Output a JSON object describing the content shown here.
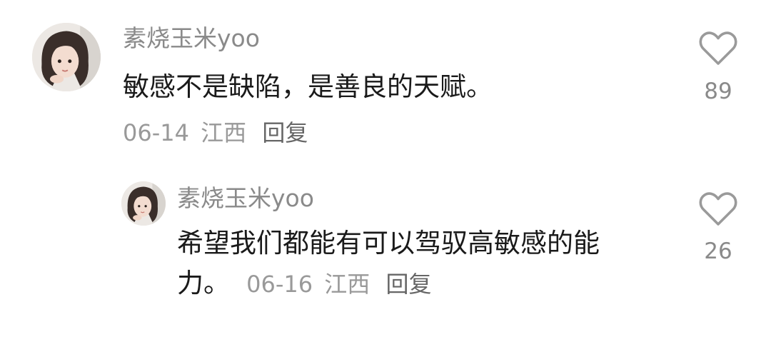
{
  "comments": [
    {
      "username": "素烧玉米yoo",
      "text": "敏感不是缺陷，是善良的天赋。",
      "date": "06-14",
      "location": "江西",
      "reply_label": "回复",
      "like_count": "89",
      "like_icon": "heart-outline-icon"
    }
  ],
  "replies": [
    {
      "username": "素烧玉米yoo",
      "text_line1": "希望我们都能有可以驾驭高敏感的能",
      "text_line2": "力。",
      "date": "06-16",
      "location": "江西",
      "reply_label": "回复",
      "like_count": "26",
      "like_icon": "heart-outline-icon"
    }
  ]
}
